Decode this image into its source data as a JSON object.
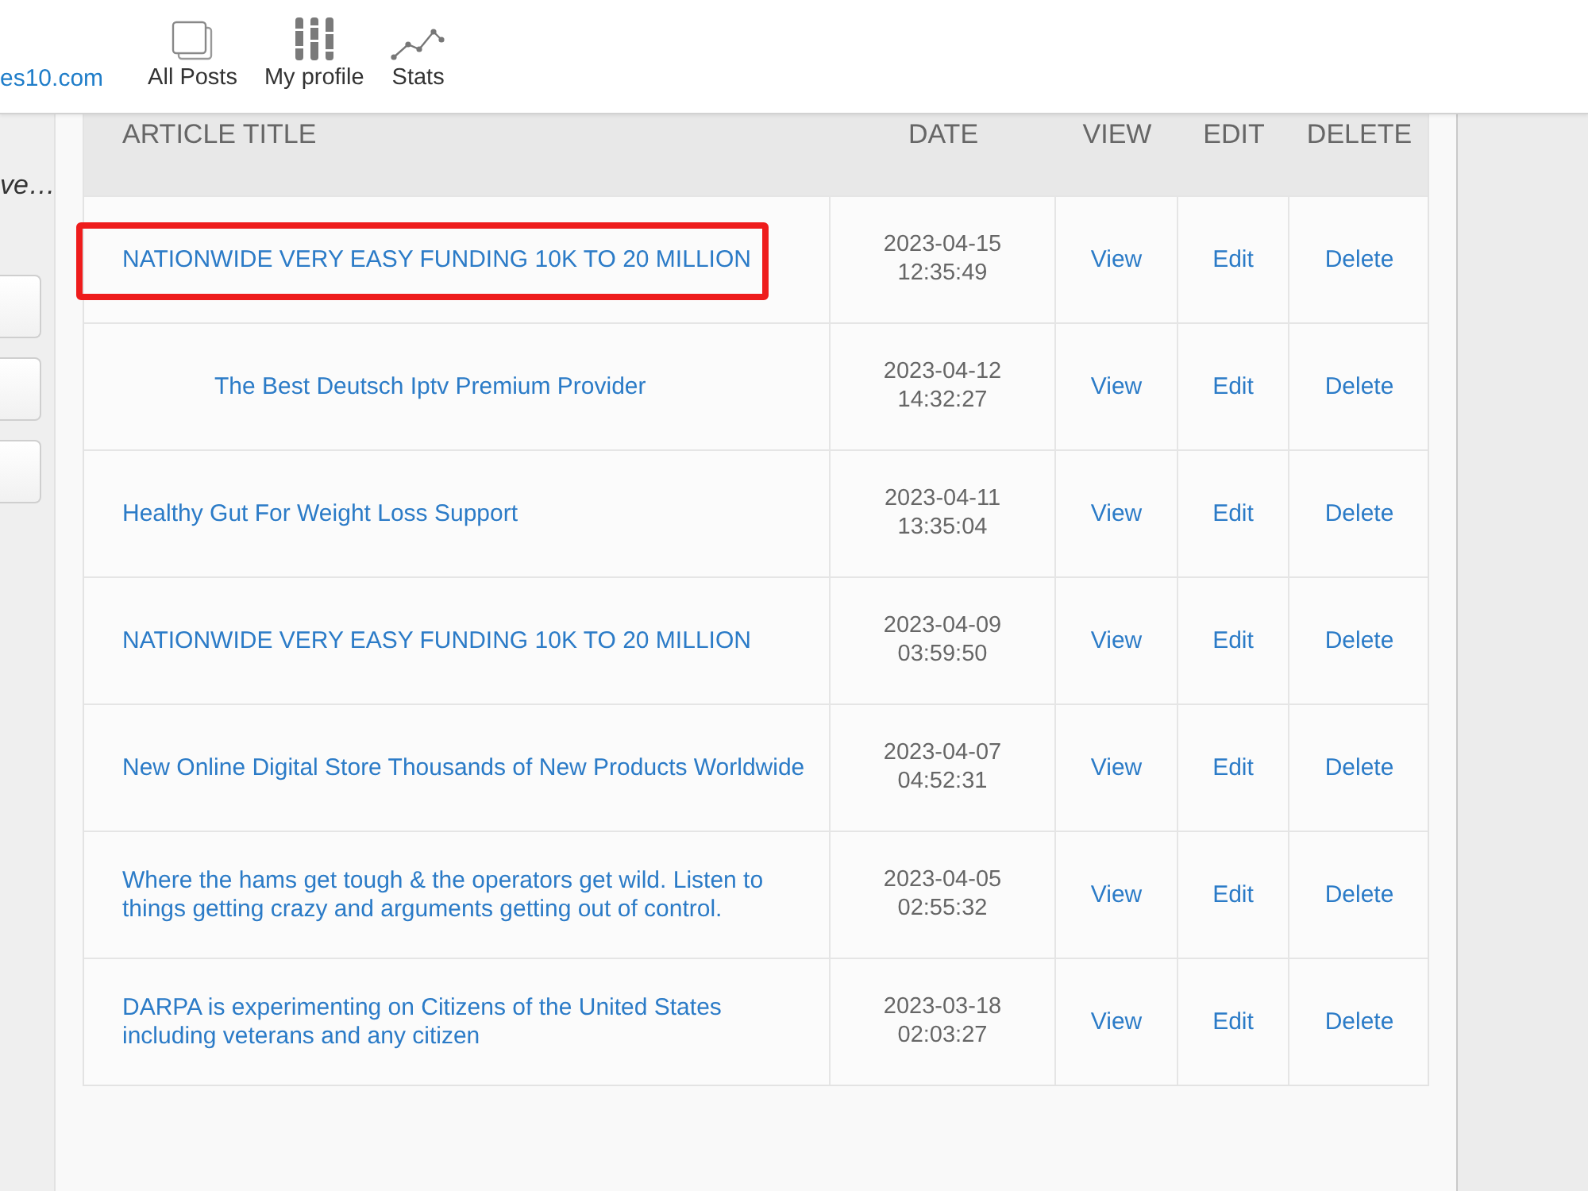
{
  "top_bar": {
    "site_link": "es10.com",
    "nav": [
      {
        "label": "All Posts",
        "kind": "pages"
      },
      {
        "label": "My profile",
        "kind": "sliders"
      },
      {
        "label": "Stats",
        "kind": "chart"
      }
    ]
  },
  "sidebar": {
    "text": "ve…",
    "buttons": [
      {
        "kind": "blank"
      },
      {
        "kind": "blank"
      },
      {
        "kind": "blank"
      }
    ]
  },
  "table": {
    "columns": [
      "ARTICLE TITLE",
      "DATE",
      "VIEW",
      "EDIT",
      "DELETE"
    ],
    "rows": [
      {
        "title": "NATIONWIDE VERY EASY FUNDING 10K TO 20 MILLION",
        "date": "2023-04-15 12:35:49",
        "view": "View",
        "edit": "Edit",
        "delete": "Delete",
        "highlighted": true,
        "indented": false
      },
      {
        "title": "The Best Deutsch Iptv Premium Provider",
        "date": "2023-04-12 14:32:27",
        "view": "View",
        "edit": "Edit",
        "delete": "Delete",
        "highlighted": false,
        "indented": true
      },
      {
        "title": "Healthy Gut For Weight Loss Support",
        "date": "2023-04-11 13:35:04",
        "view": "View",
        "edit": "Edit",
        "delete": "Delete",
        "highlighted": false,
        "indented": false
      },
      {
        "title": "NATIONWIDE VERY EASY FUNDING 10K TO 20 MILLION",
        "date": "2023-04-09 03:59:50",
        "view": "View",
        "edit": "Edit",
        "delete": "Delete",
        "highlighted": false,
        "indented": false
      },
      {
        "title": "New Online Digital Store Thousands of New Products Worldwide",
        "date": "2023-04-07 04:52:31",
        "view": "View",
        "edit": "Edit",
        "delete": "Delete",
        "highlighted": false,
        "indented": false
      },
      {
        "title": "Where the hams get tough & the operators get wild. Listen to things getting crazy and arguments getting out of control.",
        "date": "2023-04-05 02:55:32",
        "view": "View",
        "edit": "Edit",
        "delete": "Delete",
        "highlighted": false,
        "indented": false
      },
      {
        "title": "DARPA is experimenting on Citizens of the United States including veterans and any citizen",
        "date": "2023-03-18 02:03:27",
        "view": "View",
        "edit": "Edit",
        "delete": "Delete",
        "highlighted": false,
        "indented": false
      }
    ]
  }
}
